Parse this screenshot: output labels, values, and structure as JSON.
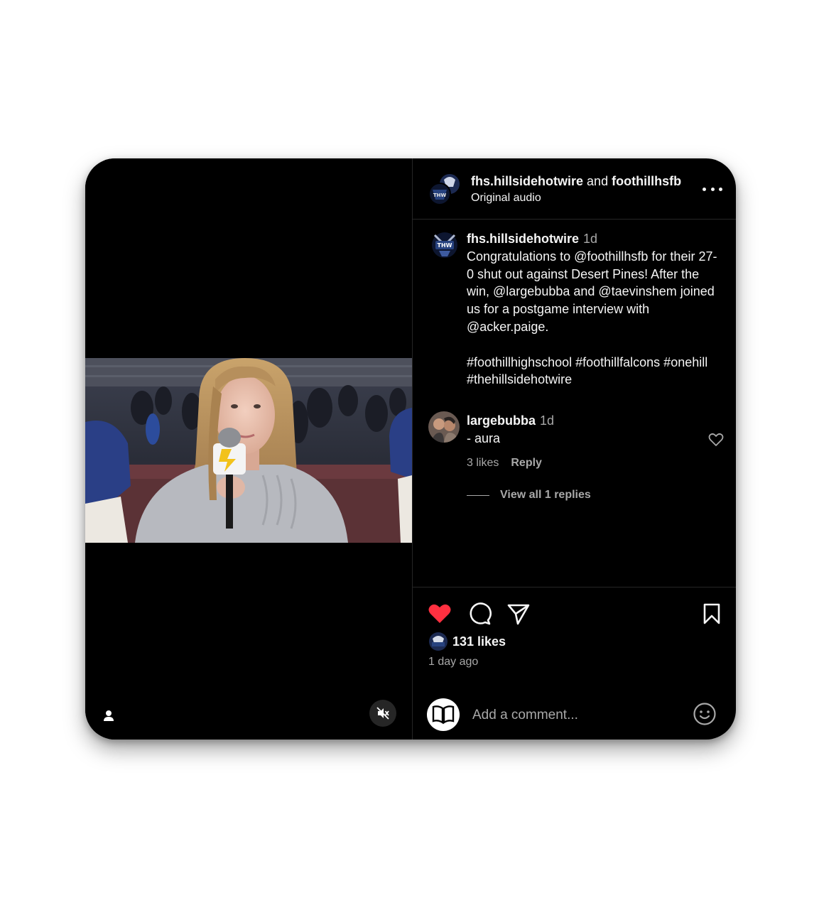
{
  "header": {
    "author": "fhs.hillsidehotwire",
    "joiner": "and",
    "collaborator": "foothillhsfb",
    "audio": "Original audio",
    "avatar_icon": "fhs-hillside-hotwire-logo"
  },
  "caption": {
    "username": "fhs.hillsidehotwire",
    "time": "1d",
    "text": "Congratulations to @foothillhsfb for their 27-0 shut out against Desert Pines! After the win, @largebubba and @taevinshem joined us for a postgame interview with @acker.paige.\n\n#foothillhighschool #foothillfalcons #onehill #thehillsidehotwire"
  },
  "comment": {
    "username": "largebubba",
    "time": "1d",
    "text": "- aura",
    "likes": "3 likes",
    "reply_label": "Reply",
    "view_replies": "View all 1 replies"
  },
  "post": {
    "likes": "131 likes",
    "date": "1 day ago",
    "liked": true,
    "accent_color": "#ff3040"
  },
  "composer": {
    "placeholder": "Add a comment..."
  },
  "icons": {
    "like": "heart-filled-icon",
    "comment": "speech-bubble-icon",
    "share": "paper-plane-icon",
    "save": "bookmark-icon",
    "mute": "speaker-muted-icon",
    "tag": "person-icon",
    "emoji": "smiley-icon",
    "more": "more-horizontal-icon"
  }
}
